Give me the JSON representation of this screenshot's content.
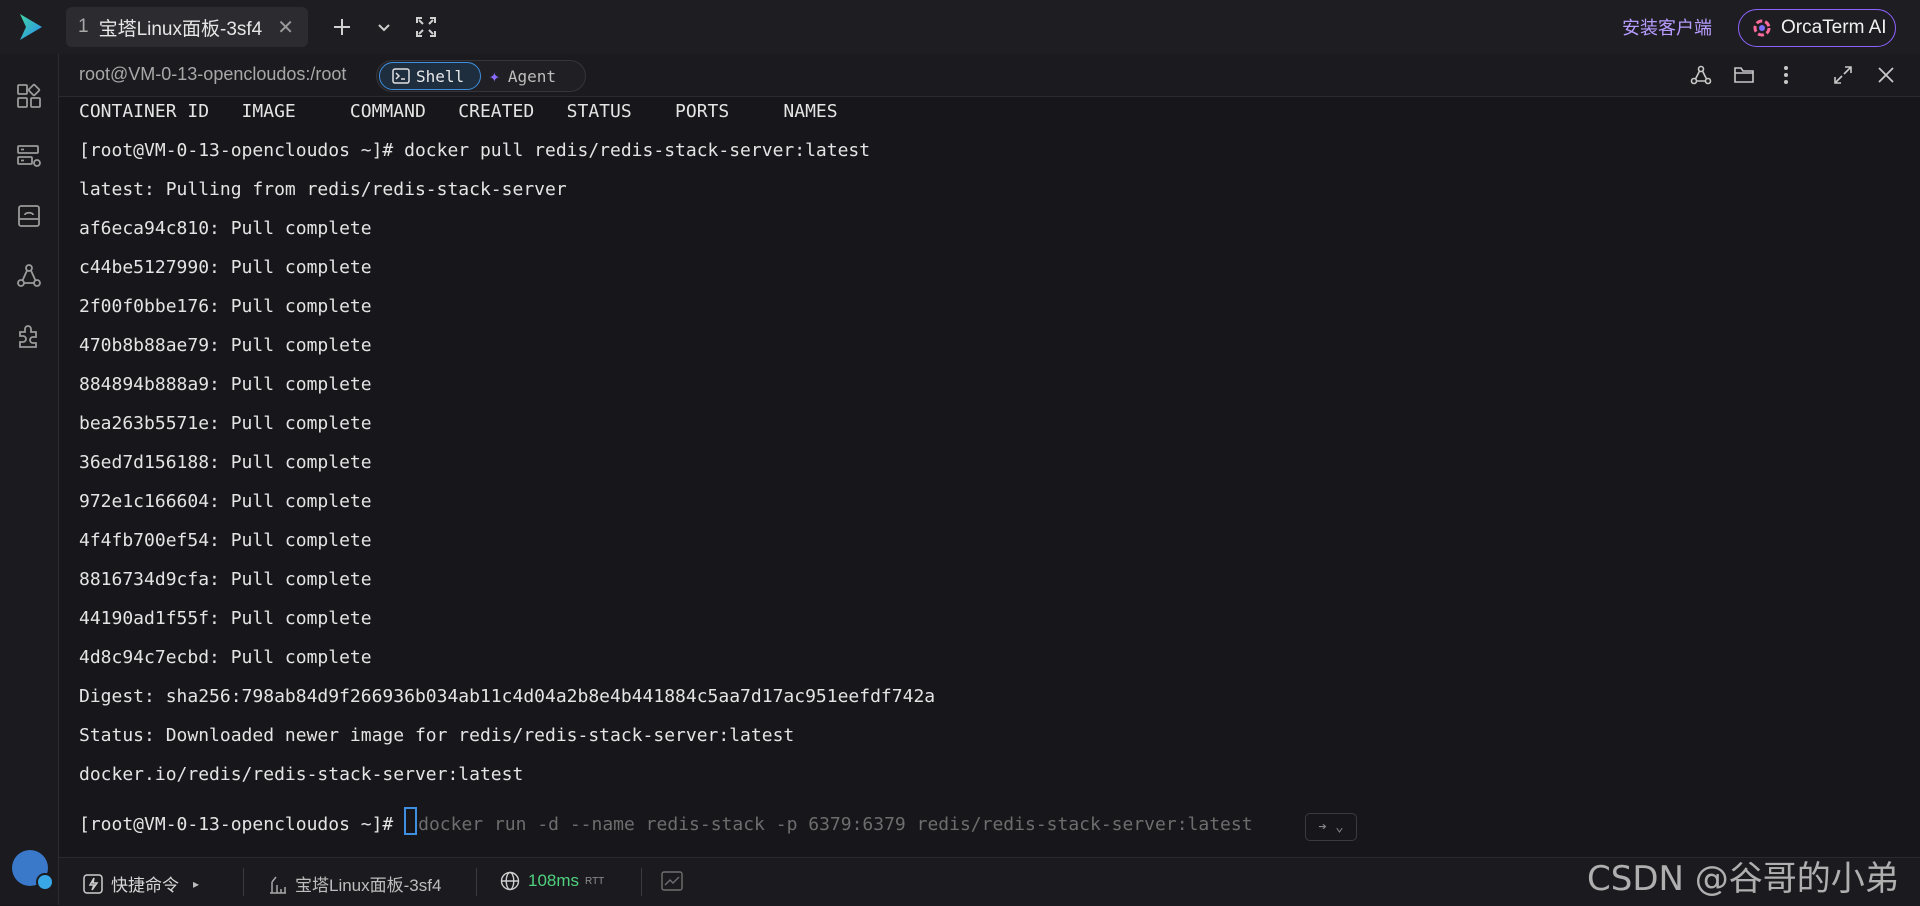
{
  "tabbar": {
    "tab_number": "1",
    "tab_title": "宝塔Linux面板-3sf4",
    "close_glyph": "✕",
    "new_tab_icon": "plus-icon",
    "tab_list_icon": "chevron-down-icon",
    "fullscreen_icon": "expand-icon",
    "install_client": "安装客户端",
    "ai_button": "OrcaTerm AI"
  },
  "sidebar": {
    "icons": [
      "apps-grid-icon",
      "server-manage-icon",
      "drive-icon",
      "network-icon",
      "extension-icon"
    ],
    "avatar": "user-avatar"
  },
  "terminal_header": {
    "path": "root@VM-0-13-opencloudos:/root",
    "mode_shell": "Shell",
    "mode_agent": "Agent",
    "right_icons": [
      "share-icon",
      "folder-icon",
      "more-icon",
      "maximize-icon",
      "close-icon"
    ]
  },
  "terminal": {
    "lines": [
      "CONTAINER ID   IMAGE     COMMAND   CREATED   STATUS    PORTS     NAMES",
      "[root@VM-0-13-opencloudos ~]# docker pull redis/redis-stack-server:latest",
      "latest: Pulling from redis/redis-stack-server",
      "af6eca94c810: Pull complete",
      "c44be5127990: Pull complete",
      "2f00f0bbe176: Pull complete",
      "470b8b88ae79: Pull complete",
      "884894b888a9: Pull complete",
      "bea263b5571e: Pull complete",
      "36ed7d156188: Pull complete",
      "972e1c166604: Pull complete",
      "4f4fb700ef54: Pull complete",
      "8816734d9cfa: Pull complete",
      "44190ad1f55f: Pull complete",
      "4d8c94c7ecbd: Pull complete",
      "Digest: sha256:798ab84d9f266936b034ab11c4d04a2b8e4b441884c5aa7d17ac951eefdf742a",
      "Status: Downloaded newer image for redis/redis-stack-server:latest",
      "docker.io/redis/redis-stack-server:latest"
    ],
    "prompt": "[root@VM-0-13-opencloudos ~]# ",
    "suggestion": "docker run -d --name redis-stack -p 6379:6379 redis/redis-stack-server:latest",
    "suggestion_badge": "➔ ⌄"
  },
  "statusbar": {
    "shortcut_label": "快捷命令",
    "shortcut_arrow": "▸",
    "session_name": "宝塔Linux面板-3sf4",
    "latency": "108ms",
    "latency_unit": "RTT",
    "latency_color": "#4fd17e"
  },
  "watermark": "CSDN @谷哥的小弟"
}
